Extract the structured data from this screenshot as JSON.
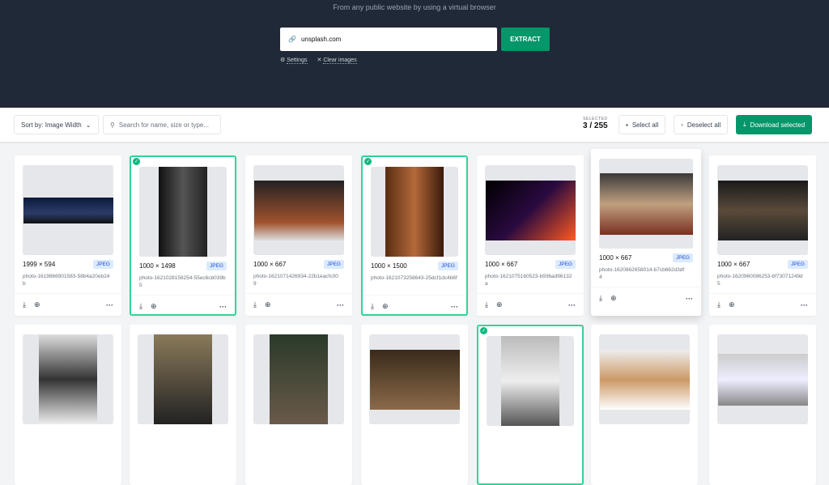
{
  "hero": {
    "subtitle": "From any public website by using a virtual browser",
    "url_value": "unsplash.com",
    "extract_label": "EXTRACT",
    "settings_label": "Settings",
    "clear_label": "Clear images"
  },
  "toolbar": {
    "sort_label": "Sort by: Image Width",
    "search_placeholder": "Search for name, size or type...",
    "selected_label": "SELECTED",
    "selected_count": "3 / 255",
    "select_all": "Select all",
    "deselect_all": "Deselect all",
    "download_selected": "Download selected"
  },
  "colors": {
    "accent": "#059669",
    "hero_bg": "#1f2937",
    "selected_border": "#34d399"
  },
  "cards": [
    {
      "dims": "1999 × 594",
      "type": "JPEG",
      "name": "photo-1619866901583-58b4a20eb24b",
      "selected": false
    },
    {
      "dims": "1000 × 1498",
      "type": "JPEG",
      "name": "photo-1621028156254-55ec6cb039b5",
      "selected": true
    },
    {
      "dims": "1000 × 667",
      "type": "JPEG",
      "name": "photo-1621071426934-22b1eacfc009",
      "selected": false
    },
    {
      "dims": "1000 × 1500",
      "type": "JPEG",
      "name": "photo-1621073258643-25dcf1dc4b6f",
      "selected": true
    },
    {
      "dims": "1000 × 667",
      "type": "JPEG",
      "name": "photo-1621075160523-b936ad96132a",
      "selected": false
    },
    {
      "dims": "1000 × 667",
      "type": "JPEG",
      "name": "photo-1620862658014-b7cb662d3df4",
      "selected": false
    },
    {
      "dims": "1000 × 667",
      "type": "JPEG",
      "name": "photo-1620960086253-bf73071249d5",
      "selected": false
    }
  ]
}
